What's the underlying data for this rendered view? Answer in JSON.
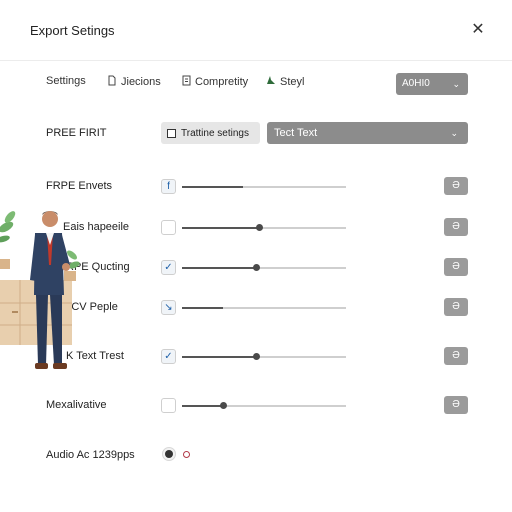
{
  "window": {
    "title": "Export Setings",
    "close_glyph": "✕"
  },
  "tabs": [
    {
      "label": "Settings",
      "icon": ""
    },
    {
      "label": "Jiecions",
      "icon": "document-icon"
    },
    {
      "label": "Compretity",
      "icon": "file-icon"
    },
    {
      "label": "Steyl",
      "icon": "style-icon"
    }
  ],
  "top_select": {
    "value": "A0HI0",
    "chevron": "⌄"
  },
  "preset": {
    "label": "PREE FIRIT",
    "button_label": "Trattine setings",
    "select_value": "Tect Text",
    "chevron": "⌄"
  },
  "rows": [
    {
      "label": "FRPE Envets",
      "check_glyph": "f",
      "checked": true,
      "level": 0.37,
      "knob": false,
      "action": "Ə"
    },
    {
      "label": "Eais hapeeile",
      "check_glyph": "",
      "checked": false,
      "level": 0.47,
      "knob": true,
      "action": "Ə"
    },
    {
      "label": "RPE Qucting",
      "check_glyph": "✓",
      "checked": true,
      "level": 0.45,
      "knob": true,
      "action": "Ə"
    },
    {
      "label": "ACV Peple",
      "check_glyph": "↘",
      "checked": true,
      "level": 0.25,
      "knob": false,
      "action": "Ə"
    },
    {
      "label": "K Text Trest",
      "check_glyph": "✓",
      "checked": true,
      "level": 0.45,
      "knob": true,
      "action": "Ə"
    },
    {
      "label": "Mexalivative",
      "check_glyph": "",
      "checked": false,
      "level": 0.25,
      "knob": true,
      "action": "Ə"
    }
  ],
  "audio": {
    "label": "Audio Ac 1239pps"
  },
  "colors": {
    "accent": "#1d5fa8",
    "select_bg": "#8c8c8c",
    "button_bg": "#9b9b9b"
  }
}
